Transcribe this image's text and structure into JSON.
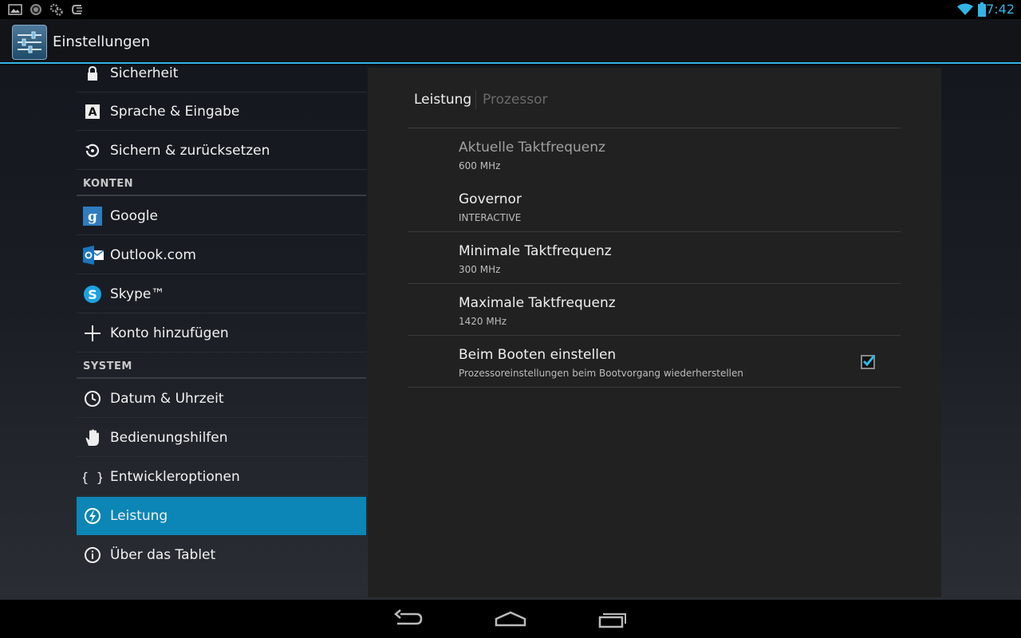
{
  "status_bar": {
    "time": "7:42",
    "left_icons": [
      "picture-icon",
      "sync-icon",
      "cogs-icon",
      "cyanogen-icon"
    ],
    "right_icons": [
      "wifi-icon",
      "battery-icon"
    ]
  },
  "action_bar": {
    "title": "Einstellungen",
    "icon": "settings-sliders-icon"
  },
  "sidebar": {
    "items_top": [
      {
        "label": "Sicherheit",
        "icon": "lock-icon"
      },
      {
        "label": "Sprache & Eingabe",
        "icon": "keyboard-a-icon"
      },
      {
        "label": "Sichern & zurücksetzen",
        "icon": "restore-icon"
      }
    ],
    "headers": {
      "accounts": "KONTEN",
      "system": "SYSTEM"
    },
    "accounts": [
      {
        "label": "Google",
        "icon": "google-icon"
      },
      {
        "label": "Outlook.com",
        "icon": "outlook-icon"
      },
      {
        "label": "Skype™",
        "icon": "skype-icon"
      },
      {
        "label": "Konto hinzufügen",
        "icon": "plus-icon"
      }
    ],
    "system": [
      {
        "label": "Datum & Uhrzeit",
        "icon": "clock-icon"
      },
      {
        "label": "Bedienungshilfen",
        "icon": "hand-icon"
      },
      {
        "label": "Entwickleroptionen",
        "icon": "braces-icon"
      },
      {
        "label": "Leistung",
        "icon": "performance-icon",
        "active": true
      },
      {
        "label": "Über das Tablet",
        "icon": "info-icon"
      }
    ]
  },
  "panel": {
    "tabs": [
      {
        "label": "Leistung",
        "active": true
      },
      {
        "label": "Prozessor",
        "active": false
      }
    ],
    "prefs": [
      {
        "title": "Aktuelle Taktfrequenz",
        "summary": "600 MHz",
        "enabled": false
      },
      {
        "title": "Governor",
        "summary": "INTERACTIVE",
        "enabled": true
      },
      {
        "title": "Minimale Taktfrequenz",
        "summary": "300 MHz",
        "enabled": true
      },
      {
        "title": "Maximale Taktfrequenz",
        "summary": "1420 MHz",
        "enabled": true
      },
      {
        "title": "Beim Booten einstellen",
        "summary": "Prozessoreinstellungen beim Bootvorgang wiederherstellen",
        "enabled": true,
        "checked": true
      }
    ]
  },
  "nav_bar": {
    "buttons": [
      "back-icon",
      "home-icon",
      "recents-icon"
    ]
  },
  "colors": {
    "accent": "#33b5e5",
    "active_item": "#0c86b6",
    "panel_bg": "#212121"
  }
}
